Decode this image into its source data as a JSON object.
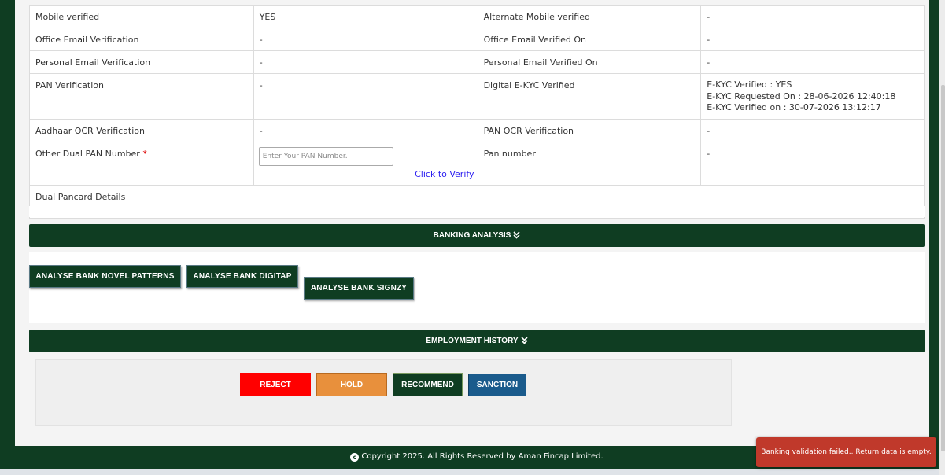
{
  "verification": {
    "rows": [
      {
        "l1": "Mobile verified",
        "v1": "YES",
        "l2": "Alternate Mobile verified",
        "v2": "-"
      },
      {
        "l1": "Office Email Verification",
        "v1": "-",
        "l2": "Office Email Verified On",
        "v2": "-"
      },
      {
        "l1": "Personal Email Verification",
        "v1": "-",
        "l2": "Personal Email Verified On",
        "v2": "-"
      },
      {
        "l1": "PAN Verification",
        "v1": "-",
        "l2": "Digital E-KYC Verified"
      },
      {
        "l1": "Aadhaar OCR Verification",
        "v1": "-",
        "l2": "PAN OCR Verification",
        "v2": "-"
      },
      {
        "l1": "Other Dual PAN Number",
        "req": "*",
        "l2": "Pan number",
        "v2": "-"
      }
    ],
    "ekyc": {
      "verified": "E-KYC Verified : YES",
      "requested_on": "E-KYC Requested On : 28-06-2026 12:40:18",
      "verified_on": "E-KYC Verified on : 30-07-2026 13:12:17"
    },
    "pan_input": {
      "placeholder": "Enter Your PAN Number.",
      "value": ""
    },
    "verify_link": "Click to Verify",
    "dual_pancard_label": "Dual Pancard Details"
  },
  "banking_analysis": {
    "title": "BANKING ANALYSIS",
    "chevron": "»",
    "buttons": [
      "ANALYSE BANK NOVEL PATTERNS",
      "ANALYSE BANK DIGITAP",
      "ANALYSE BANK SIGNZY"
    ]
  },
  "employment_history": {
    "title": "EMPLOYMENT HISTORY",
    "chevron": "»"
  },
  "actions": {
    "reject": "REJECT",
    "hold": "HOLD",
    "recommend": "RECOMMEND",
    "sanction": "SANCTION"
  },
  "footer": {
    "copyright_symbol": "c",
    "text": "Copyright 2025. All Rights Reserved by Aman Fincap Limited."
  },
  "toast": {
    "message": "Banking validation failed.. Return data is empty."
  },
  "colors": {
    "brand_green": "#0f3d22",
    "reject": "#ff0000",
    "hold": "#e8903c",
    "sanction": "#1a5b8c",
    "toast": "#c0392b",
    "link": "#2a1df0"
  }
}
